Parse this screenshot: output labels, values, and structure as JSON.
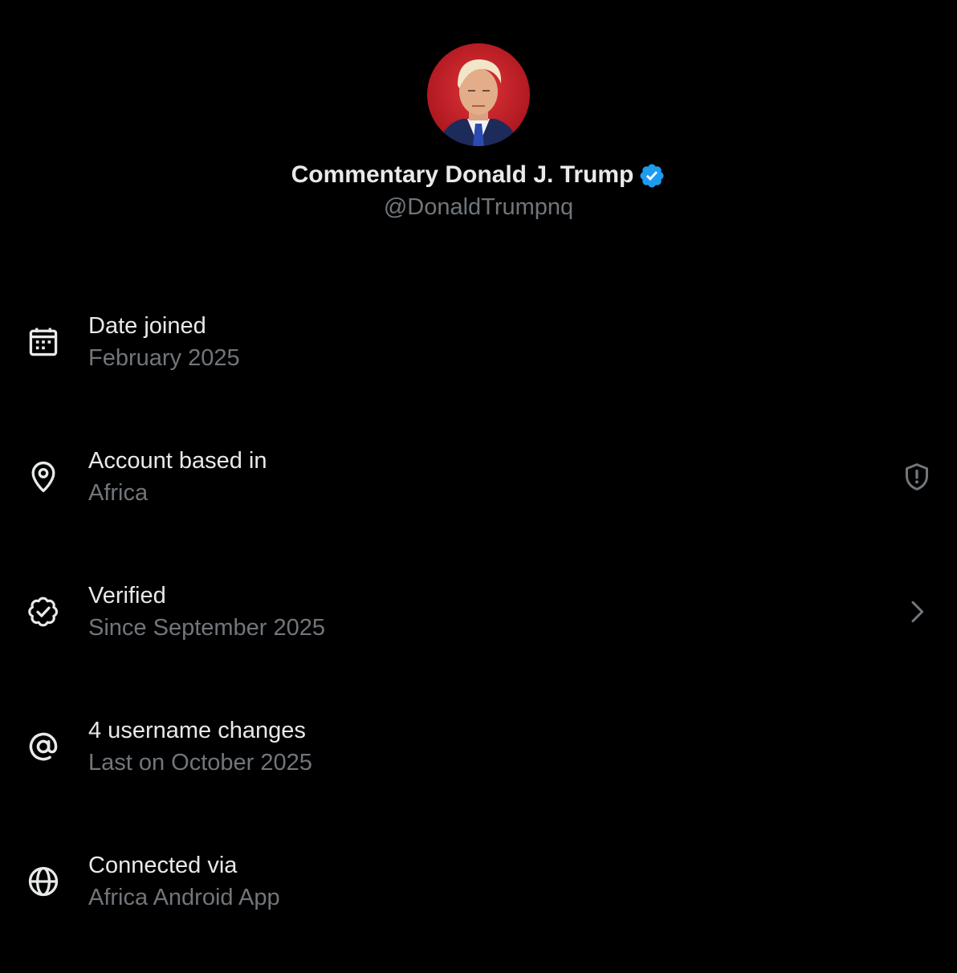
{
  "profile": {
    "display_name": "Commentary Donald J. Trump",
    "handle": "@DonaldTrumpnq",
    "verified": true,
    "avatar_icon": "profile-photo",
    "badge_color": "#1d9bf0"
  },
  "colors": {
    "background": "#000000",
    "primary_text": "#e7e9ea",
    "secondary_text": "#71767b",
    "accent": "#1d9bf0"
  },
  "about_rows": [
    {
      "icon": "calendar-icon",
      "title": "Date joined",
      "value": "February 2025"
    },
    {
      "icon": "location-pin-icon",
      "title": "Account based in",
      "value": "Africa",
      "trailing_icon": "shield-alert-icon"
    },
    {
      "icon": "verified-badge-outline-icon",
      "title": "Verified",
      "value": "Since September 2025",
      "trailing_icon": "chevron-right-icon"
    },
    {
      "icon": "at-sign-icon",
      "title": "4 username changes",
      "value": "Last on October 2025"
    },
    {
      "icon": "globe-icon",
      "title": "Connected via",
      "value": "Africa Android App"
    }
  ]
}
